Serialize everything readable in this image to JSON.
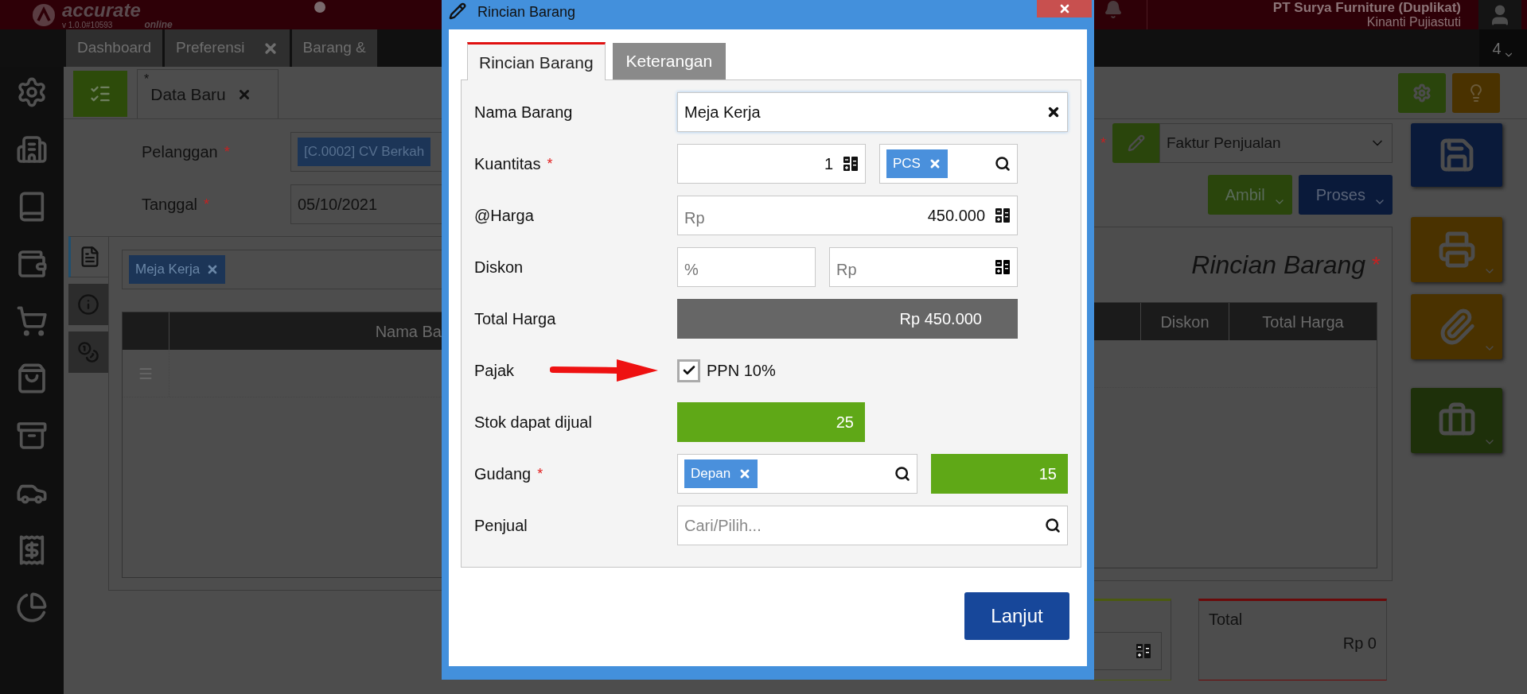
{
  "header": {
    "logo": "accurate",
    "logo_sub": "online",
    "version": "v 1.0.0#10593",
    "company": "PT Surya Furniture (Duplikat)",
    "user": "Kinanti Pujiastuti"
  },
  "tabs": [
    {
      "label": "Dashboard",
      "closable": false
    },
    {
      "label": "Preferensi",
      "closable": true
    },
    {
      "label": "Barang &",
      "closable": false
    }
  ],
  "tab_overflow": "4",
  "form": {
    "tab": {
      "mark": "*",
      "label": "Data Baru"
    },
    "customer": {
      "label": "Pelanggan",
      "required": true,
      "value": "[C.0002] CV Berkah"
    },
    "date": {
      "label": "Tanggal",
      "required": true,
      "value": "05/10/2021"
    },
    "doc_type": {
      "required": true,
      "value": "Faktur Penjualan"
    },
    "actions": [
      {
        "label": "Ambil",
        "kind": "green"
      },
      {
        "label": "Proses",
        "kind": "blue"
      }
    ],
    "side_tabs": [
      {
        "kind": "list",
        "selected": true
      },
      {
        "kind": "info",
        "selected": false
      },
      {
        "kind": "money",
        "selected": false
      }
    ],
    "item_tag": "Meja Kerja",
    "details_title": "Rincian Barang",
    "columns_left": [
      "Nama Ba"
    ],
    "columns_right": [
      "Diskon",
      "Total Harga"
    ],
    "total": {
      "label": "Total",
      "value": "Rp 0"
    }
  },
  "dialog": {
    "title": "Rincian Barang",
    "tabs": [
      {
        "label": "Rincian Barang",
        "selected": true
      },
      {
        "label": "Keterangan",
        "selected": false
      }
    ],
    "rows": [
      {
        "kind": "text",
        "label": "Nama Barang",
        "required": false,
        "value": "Meja Kerja"
      },
      {
        "kind": "quantity",
        "label": "Kuantitas",
        "required": true,
        "value": "1",
        "unit": "PCS"
      },
      {
        "kind": "price",
        "label": "@Harga",
        "required": false,
        "prefix": "Rp",
        "value": "450.000"
      },
      {
        "kind": "discount",
        "label": "Diskon",
        "required": false,
        "percent_placeholder": "%",
        "amount_placeholder": "Rp"
      },
      {
        "kind": "total",
        "label": "Total Harga",
        "required": false,
        "value": "Rp 450.000"
      },
      {
        "kind": "checkbox",
        "label": "Pajak",
        "required": false,
        "option": "PPN 10%",
        "checked": true
      },
      {
        "kind": "stock",
        "label": "Stok dapat dijual",
        "required": false,
        "value": "25"
      },
      {
        "kind": "warehouse",
        "label": "Gudang",
        "required": true,
        "value": "Depan",
        "stock": "15"
      },
      {
        "kind": "search",
        "label": "Penjual",
        "required": false,
        "placeholder": "Cari/Pilih..."
      }
    ],
    "button": "Lanjut"
  }
}
